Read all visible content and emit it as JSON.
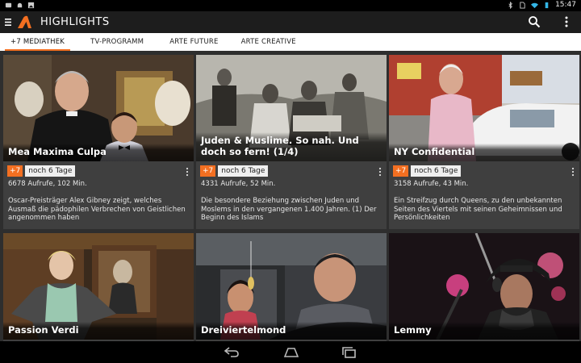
{
  "status": {
    "time": "15:47"
  },
  "app": {
    "title": "HIGHLIGHTS"
  },
  "tabs": [
    {
      "label": "+7 MEDIATHEK",
      "active": true
    },
    {
      "label": "TV-PROGRAMM",
      "active": false
    },
    {
      "label": "ARTE FUTURE",
      "active": false
    },
    {
      "label": "ARTE CREATIVE",
      "active": false
    }
  ],
  "cards": [
    {
      "title": "Mea Maxima Culpa",
      "badge": "+7",
      "availability": "noch 6 Tage",
      "views": "6678 Aufrufe,",
      "duration": "102 Min.",
      "description": "Oscar-Preisträger Alex Gibney zeigt, welches Ausmaß die pädophilen Verbrechen von Geistlichen angenommen haben"
    },
    {
      "title": "Juden & Muslime. So nah. Und doch so fern! (1/4)",
      "badge": "+7",
      "availability": "noch 6 Tage",
      "views": "4331 Aufrufe,",
      "duration": "52 Min.",
      "description": "Die besondere Beziehung zwischen Juden und Moslems in den vergangenen 1.400 Jahren. (1) Der Beginn des Islams"
    },
    {
      "title": "NY Confidential",
      "badge": "+7",
      "availability": "noch 6 Tage",
      "views": "3158 Aufrufe,",
      "duration": "43 Min.",
      "description": "Ein Streifzug durch Queens, zu den unbekannten Seiten des Viertels mit seinen Geheimnissen und Persönlichkeiten"
    },
    {
      "title": "Passion Verdi"
    },
    {
      "title": "Dreiviertelmond"
    },
    {
      "title": "Lemmy"
    }
  ],
  "colors": {
    "accent": "#f36f21",
    "card_bg": "#3f3f3f",
    "grid_bg": "#2e2e2e"
  }
}
